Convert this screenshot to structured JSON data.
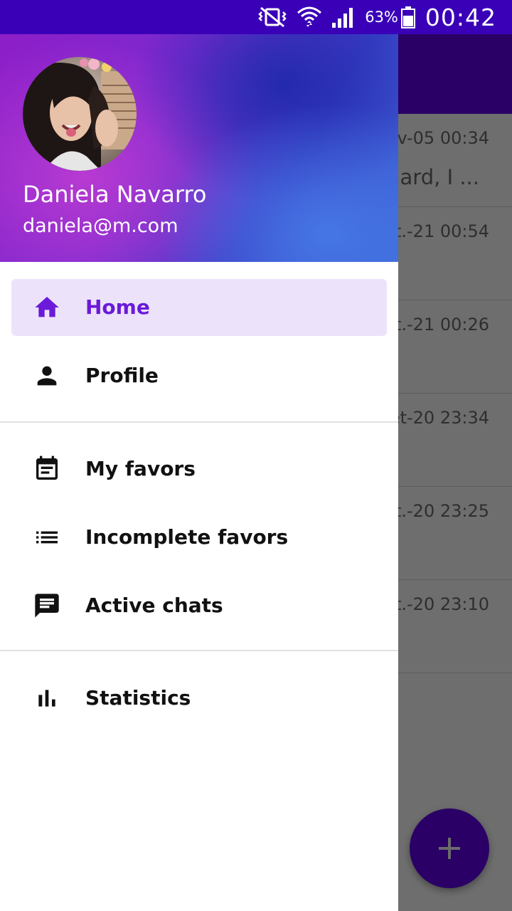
{
  "status_bar": {
    "battery_percent": "63%",
    "time": "00:42",
    "icons": [
      "vibrate-icon",
      "wifi-icon",
      "signal-icon",
      "battery-icon"
    ]
  },
  "drawer": {
    "header": {
      "name": "Daniela Navarro",
      "email": "daniela@m.com"
    },
    "groups": [
      [
        {
          "label": "Home",
          "icon": "home-icon",
          "active": true
        },
        {
          "label": "Profile",
          "icon": "person-icon",
          "active": false
        }
      ],
      [
        {
          "label": "My favors",
          "icon": "event-note-icon",
          "active": false
        },
        {
          "label": "Incomplete favors",
          "icon": "list-icon",
          "active": false
        },
        {
          "label": "Active chats",
          "icon": "chat-icon",
          "active": false
        }
      ],
      [
        {
          "label": "Statistics",
          "icon": "bar-chart-icon",
          "active": false
        }
      ]
    ]
  },
  "background_list": {
    "rows": [
      {
        "date": "v-05  00:34",
        "preview": "hard, I ..."
      },
      {
        "date": "t.-21  00:54",
        "preview": ""
      },
      {
        "date": "t.-21  00:26",
        "preview": ""
      },
      {
        "date": "et-20  23:34",
        "preview": ""
      },
      {
        "date": "t.-20  23:25",
        "preview": ""
      },
      {
        "date": "t.-20  23:10",
        "preview": ""
      }
    ]
  },
  "colors": {
    "status_bar": "#3a00b8",
    "toolbar": "#2a0066",
    "accent": "#6a1ad8",
    "active_item_bg": "#ece3fb"
  }
}
